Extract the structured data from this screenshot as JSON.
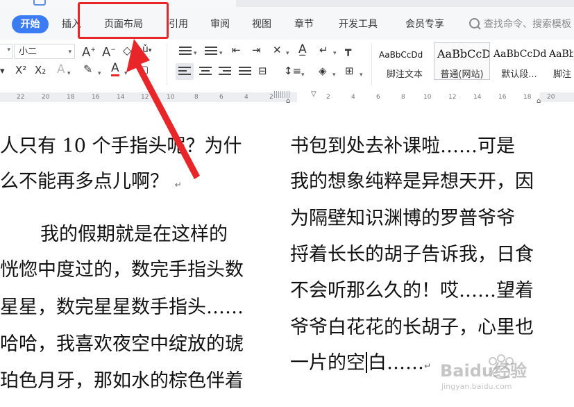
{
  "menubar": {
    "items": [
      {
        "label": "开始",
        "active": true
      },
      {
        "label": "插入"
      },
      {
        "label": "页面布局"
      },
      {
        "label": "引用"
      },
      {
        "label": "审阅"
      },
      {
        "label": "视图"
      },
      {
        "label": "章节"
      },
      {
        "label": "开发工具"
      },
      {
        "label": "会员专享"
      }
    ],
    "search_label": "查找命令、搜索模板"
  },
  "toolbar": {
    "font_size": "小二",
    "styles": [
      {
        "sample": "AaBbCcDd",
        "name": "脚注文本"
      },
      {
        "sample": "AaBbCcDd",
        "name": "普通(网站)"
      },
      {
        "sample": "AaBbCcDd",
        "name": "默认段..."
      },
      {
        "sample": "AaBb",
        "name": "脚注"
      }
    ]
  },
  "ruler": {
    "left_numbers": [
      "22",
      "20",
      "18",
      "16",
      "14",
      "12",
      "10",
      "8",
      "6",
      "4",
      "2"
    ],
    "right_numbers": [
      "2",
      "4",
      "6",
      "8",
      "10",
      "12",
      "14",
      "16",
      "18",
      "20"
    ]
  },
  "document": {
    "left_column": [
      "人只有 10 个手指头呢？为什",
      "么不能再多点儿啊？",
      "我的假期就是在这样的",
      "恍惚中度过的，数完手指头数",
      "星星，数完星星数手指头……",
      "哈哈，我喜欢夜空中绽放的琥",
      "珀色月牙，那如水的棕色伴着"
    ],
    "right_column": [
      "书包到处去补课啦……可是",
      "我的想象纯粹是异想天开，因",
      "为隔壁知识渊博的罗普爷爷",
      "捋着长长的胡子告诉我，日食",
      "不会听那么久的！哎……望着",
      "爷爷白花花的长胡子，心里也",
      "一片的空",
      "白……"
    ]
  },
  "watermark": {
    "brand": "Baidu经验",
    "url": "jingyan.baidu.com"
  },
  "colors": {
    "accent": "#3b7cf6",
    "annotation": "#e8262a"
  }
}
